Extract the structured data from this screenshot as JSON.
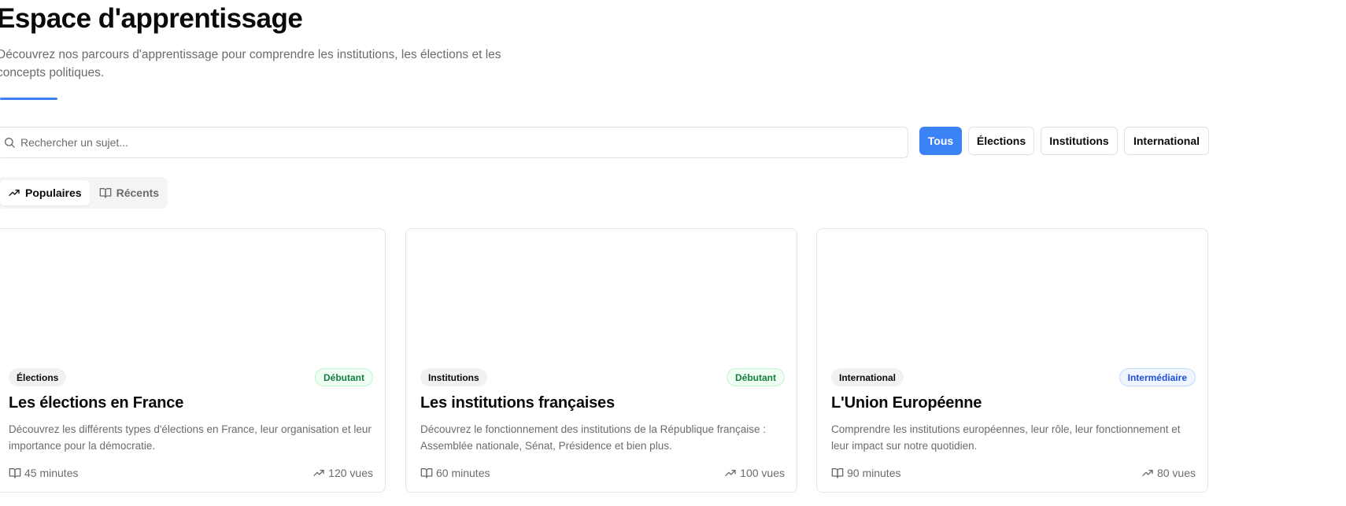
{
  "header": {
    "title": "Espace d'apprentissage",
    "subtitle": "Découvrez nos parcours d'apprentissage pour comprendre les institutions, les élections et les concepts politiques."
  },
  "search": {
    "placeholder": "Rechercher un sujet..."
  },
  "filters": [
    {
      "label": "Tous",
      "active": true
    },
    {
      "label": "Élections",
      "active": false
    },
    {
      "label": "Institutions",
      "active": false
    },
    {
      "label": "International",
      "active": false
    }
  ],
  "tabs": [
    {
      "label": "Populaires",
      "icon": "trending-up-icon",
      "active": true
    },
    {
      "label": "Récents",
      "icon": "book-open-icon",
      "active": false
    }
  ],
  "cards": [
    {
      "category": "Élections",
      "level": "Débutant",
      "title": "Les élections en France",
      "description": "Découvrez les différents types d'élections en France, leur organisation et leur importance pour la démocratie.",
      "duration": "45 minutes",
      "views": "120 vues"
    },
    {
      "category": "Institutions",
      "level": "Débutant",
      "title": "Les institutions françaises",
      "description": "Découvrez le fonctionnement des institutions de la République française : Assemblée nationale, Sénat, Présidence et bien plus.",
      "duration": "60 minutes",
      "views": "100 vues"
    },
    {
      "category": "International",
      "level": "Intermédiaire",
      "title": "L'Union Européenne",
      "description": "Comprendre les institutions européennes, leur rôle, leur fonctionnement et leur impact sur notre quotidien.",
      "duration": "90 minutes",
      "views": "80 vues"
    }
  ],
  "colors": {
    "accent": "#3b82f6",
    "beginner_text": "#15803d",
    "intermediate_text": "#1d4ed8",
    "muted_text": "#6b6b6b"
  }
}
